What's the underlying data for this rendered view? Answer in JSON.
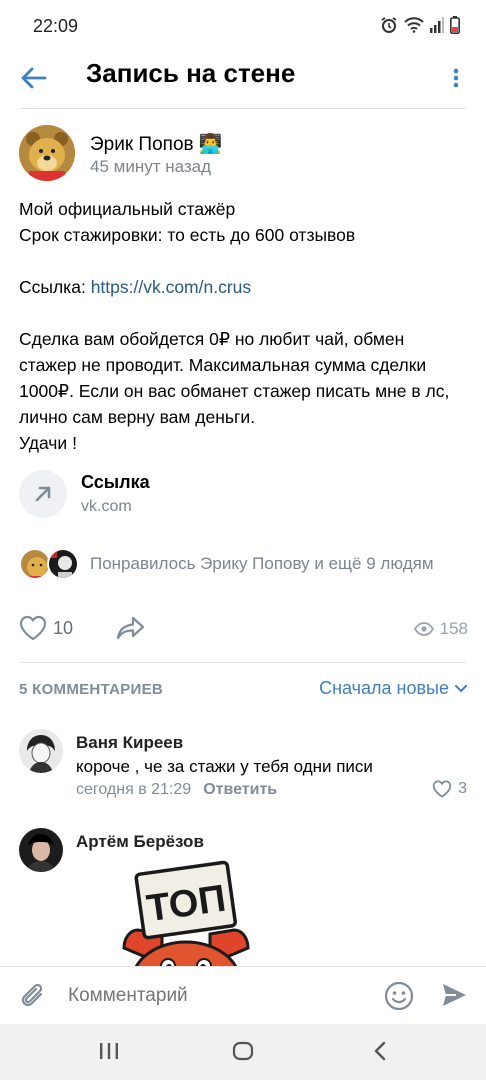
{
  "status_bar": {
    "time": "22:09",
    "icons": [
      "alarm-icon",
      "wifi-icon",
      "signal-icon",
      "battery-icon"
    ]
  },
  "header": {
    "title": "Запись на стене",
    "back_icon": "arrow-left-icon",
    "more_icon": "vertical-dots-icon"
  },
  "post": {
    "author": "Эрик Попов 👨‍💻",
    "time": "45 минут назад",
    "lines": {
      "l1": "Мой официальный стажёр",
      "l2": "Срок стажировки: то есть до 600 отзывов",
      "link_prefix": "Ссылка: ",
      "link_url": "https://vk.com/n.crus",
      "l5": "Сделка вам обойдется 0₽ но любит чай, обмен",
      "l6": "стажер не проводит. Максимальная сумма сделки",
      "l7": "1000₽. Если он вас обманет стажер писать мне в лс,",
      "l8": "лично сам верну вам деньги.",
      "l9": "Удачи !"
    },
    "attachment": {
      "title": "Ссылка",
      "domain": "vk.com",
      "icon": "arrow-up-right-icon"
    },
    "likers_text": "Понравилось Эрику Попову и ещё 9 людям",
    "likes": "10",
    "views": "158"
  },
  "comments": {
    "count_label": "5 КОММЕНТАРИЕВ",
    "sort_label": "Сначала новые",
    "items": [
      {
        "name": "Ваня Киреев",
        "text": "короче , че за стажи у тебя одни писи",
        "time": "сегодня в 21:29",
        "reply": "Ответить",
        "likes": "3"
      },
      {
        "name": "Артём Берёзов",
        "sticker_text": "ТОП"
      }
    ]
  },
  "composer": {
    "placeholder": "Комментарий"
  },
  "colors": {
    "accent": "#3f7fc0",
    "link": "#2a5885",
    "secondary_text": "#818c99"
  }
}
